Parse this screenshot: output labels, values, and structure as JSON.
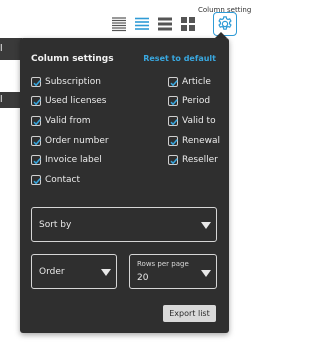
{
  "toolbar": {
    "tooltip": "Column settings",
    "icons": [
      "list-view-icon",
      "compact-list-view-icon",
      "wide-list-view-icon",
      "grid-view-icon",
      "gear-icon"
    ],
    "accent": "#2f9bd6"
  },
  "background": {
    "stub1": "l",
    "stub2": "l"
  },
  "panel": {
    "title": "Column settings",
    "reset_label": "Reset to default",
    "left_columns": [
      {
        "label": "Subscription",
        "checked": true
      },
      {
        "label": "Used licenses",
        "checked": true
      },
      {
        "label": "Valid from",
        "checked": true
      },
      {
        "label": "Order number",
        "checked": true
      },
      {
        "label": "Invoice label",
        "checked": true
      },
      {
        "label": "Contact",
        "checked": true
      }
    ],
    "right_columns": [
      {
        "label": "Article",
        "checked": true
      },
      {
        "label": "Period",
        "checked": true
      },
      {
        "label": "Valid to",
        "checked": true
      },
      {
        "label": "Renewal",
        "checked": true
      },
      {
        "label": "Reseller",
        "checked": true
      }
    ],
    "sort_by": {
      "label": "Sort by"
    },
    "order": {
      "label": "Order"
    },
    "rows_per_page": {
      "label": "Rows per page",
      "value": "20"
    },
    "export_label": "Export list",
    "link_color": "#39a8e0",
    "panel_color": "#2f2f2f"
  }
}
